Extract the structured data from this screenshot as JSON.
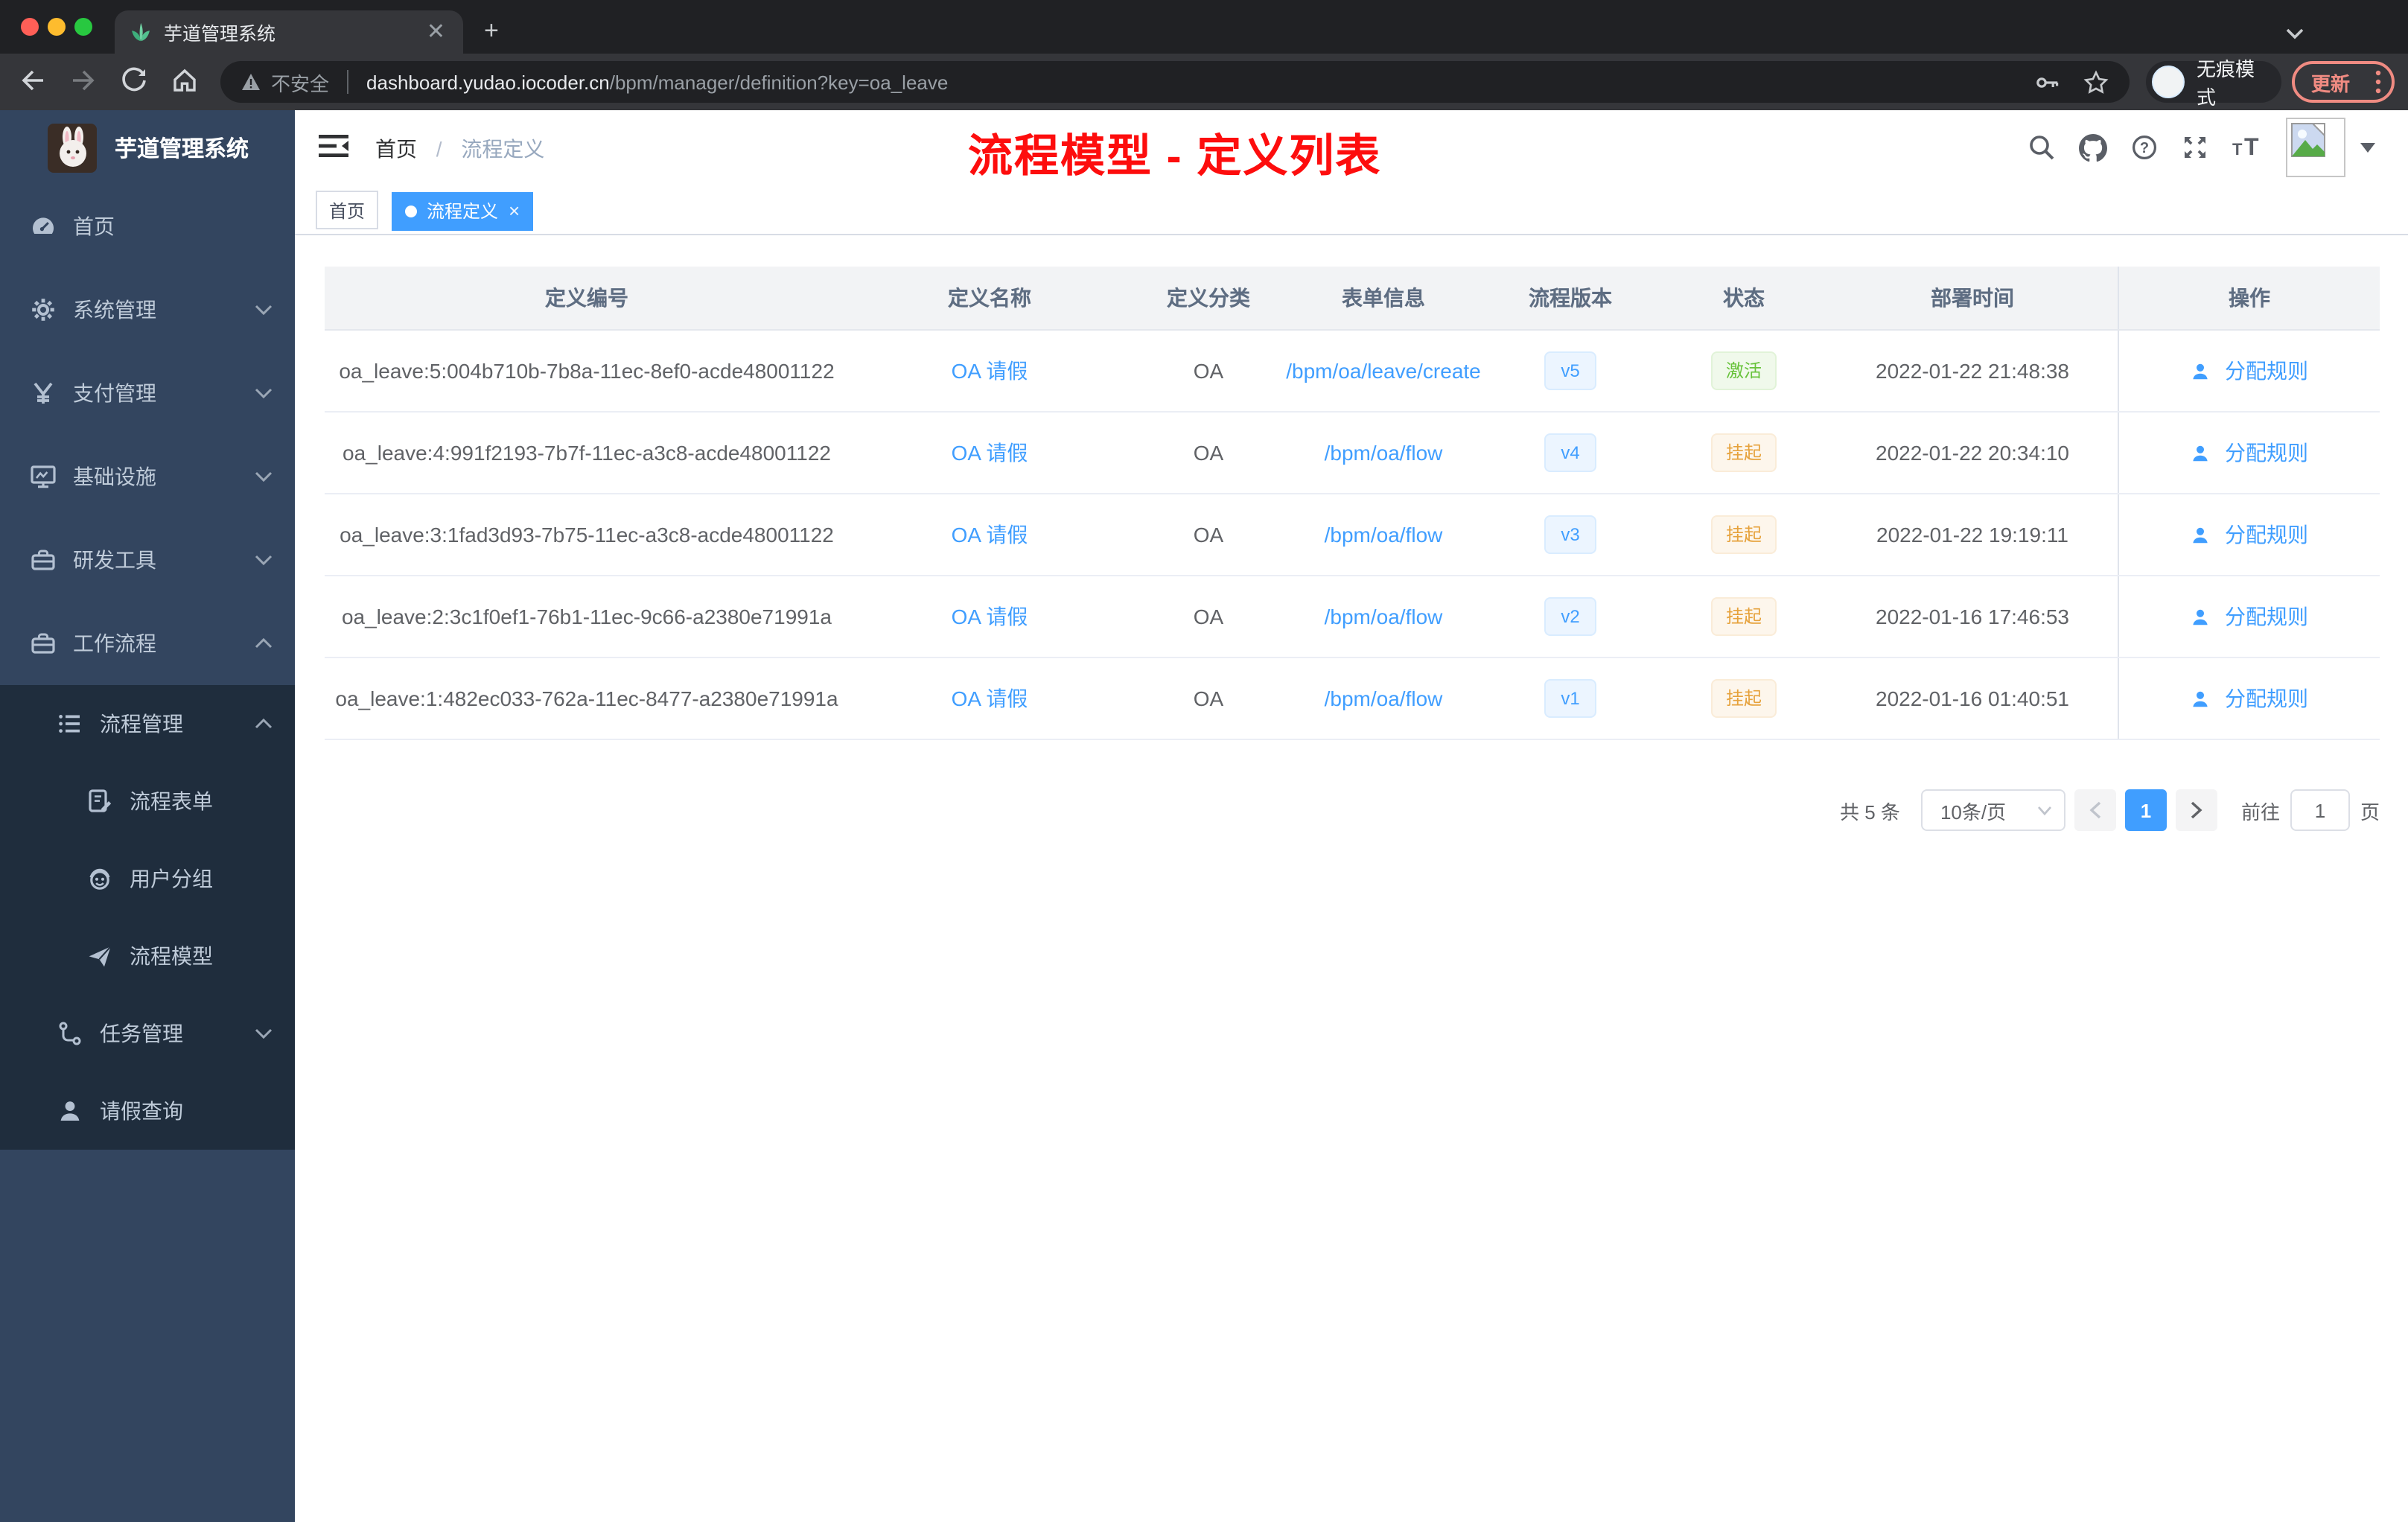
{
  "browser": {
    "tab_title": "芋道管理系统",
    "security_label": "不安全",
    "url_host": "dashboard.yudao.iocoder.cn",
    "url_path": "/bpm/manager/definition?key=oa_leave",
    "incognito_label": "无痕模式",
    "update_label": "更新"
  },
  "app": {
    "logo_title": "芋道管理系统",
    "breadcrumb": {
      "home": "首页",
      "current": "流程定义"
    },
    "annotation": "流程模型 - 定义列表",
    "annotation_color": "#fd0d0d",
    "accent_color": "#409eff",
    "tags": {
      "home": "首页",
      "active": "流程定义"
    }
  },
  "sidebar": {
    "items": [
      {
        "label": "首页"
      },
      {
        "label": "系统管理"
      },
      {
        "label": "支付管理"
      },
      {
        "label": "基础设施"
      },
      {
        "label": "研发工具"
      },
      {
        "label": "工作流程"
      },
      {
        "label": "流程管理"
      },
      {
        "label": "流程表单"
      },
      {
        "label": "用户分组"
      },
      {
        "label": "流程模型"
      },
      {
        "label": "任务管理"
      },
      {
        "label": "请假查询"
      }
    ]
  },
  "table": {
    "columns": [
      "定义编号",
      "定义名称",
      "定义分类",
      "表单信息",
      "流程版本",
      "状态",
      "部署时间",
      "操作"
    ],
    "action_label": "分配规则",
    "rows": [
      {
        "id": "oa_leave:5:004b710b-7b8a-11ec-8ef0-acde48001122",
        "name": "OA 请假",
        "category": "OA",
        "form": "/bpm/oa/leave/create",
        "version": "v5",
        "status": "激活",
        "status_type": "success",
        "time": "2022-01-22 21:48:38"
      },
      {
        "id": "oa_leave:4:991f2193-7b7f-11ec-a3c8-acde48001122",
        "name": "OA 请假",
        "category": "OA",
        "form": "/bpm/oa/flow",
        "version": "v4",
        "status": "挂起",
        "status_type": "warning",
        "time": "2022-01-22 20:34:10"
      },
      {
        "id": "oa_leave:3:1fad3d93-7b75-11ec-a3c8-acde48001122",
        "name": "OA 请假",
        "category": "OA",
        "form": "/bpm/oa/flow",
        "version": "v3",
        "status": "挂起",
        "status_type": "warning",
        "time": "2022-01-22 19:19:11"
      },
      {
        "id": "oa_leave:2:3c1f0ef1-76b1-11ec-9c66-a2380e71991a",
        "name": "OA 请假",
        "category": "OA",
        "form": "/bpm/oa/flow",
        "version": "v2",
        "status": "挂起",
        "status_type": "warning",
        "time": "2022-01-16 17:46:53"
      },
      {
        "id": "oa_leave:1:482ec033-762a-11ec-8477-a2380e71991a",
        "name": "OA 请假",
        "category": "OA",
        "form": "/bpm/oa/flow",
        "version": "v1",
        "status": "挂起",
        "status_type": "warning",
        "time": "2022-01-16 01:40:51"
      }
    ]
  },
  "pagination": {
    "total_label": "共 5 条",
    "page_size": "10条/页",
    "current_page": "1",
    "goto_label": "前往",
    "goto_value": "1",
    "page_unit": "页"
  },
  "status_colors": {
    "success": "#67c23a",
    "warning": "#e6a23c"
  }
}
